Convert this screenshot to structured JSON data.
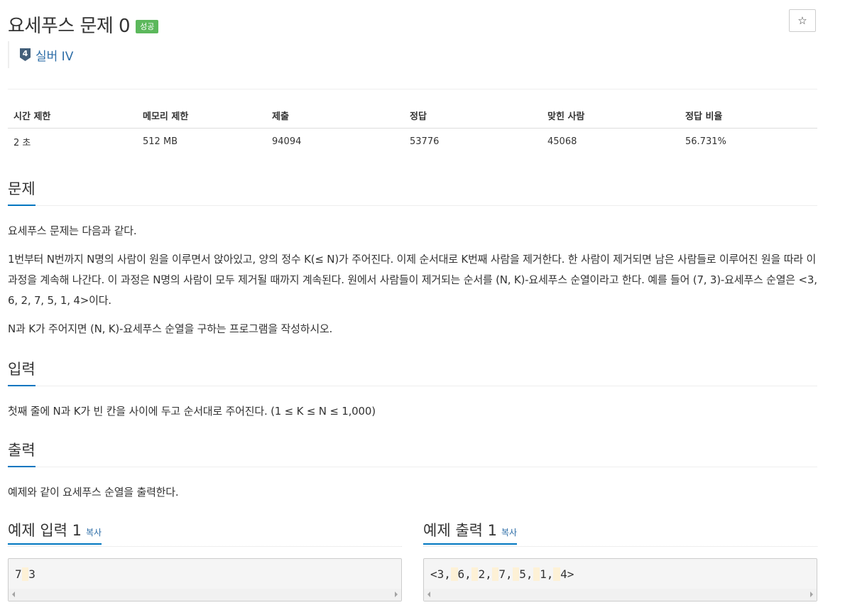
{
  "problem": {
    "title": "요세푸스 문제 0",
    "status_badge": "성공",
    "tier": "실버 IV",
    "tier_level": "4",
    "star_label": "☆"
  },
  "info_table": {
    "headers": [
      "시간 제한",
      "메모리 제한",
      "제출",
      "정답",
      "맞힌 사람",
      "정답 비율"
    ],
    "values": [
      "2 초",
      "512 MB",
      "94094",
      "53776",
      "45068",
      "56.731%"
    ]
  },
  "sections": {
    "description": {
      "title": "문제",
      "paragraphs": [
        "요세푸스 문제는 다음과 같다.",
        "1번부터 N번까지 N명의 사람이 원을 이루면서 앉아있고, 양의 정수 K(≤ N)가 주어진다. 이제 순서대로 K번째 사람을 제거한다. 한 사람이 제거되면 남은 사람들로 이루어진 원을 따라 이 과정을 계속해 나간다. 이 과정은 N명의 사람이 모두 제거될 때까지 계속된다. 원에서 사람들이 제거되는 순서를 (N, K)-요세푸스 순열이라고 한다. 예를 들어 (7, 3)-요세푸스 순열은 <3, 6, 2, 7, 5, 1, 4>이다.",
        "N과 K가 주어지면 (N, K)-요세푸스 순열을 구하는 프로그램을 작성하시오."
      ]
    },
    "input": {
      "title": "입력",
      "text": "첫째 줄에 N과 K가 빈 칸을 사이에 두고 순서대로 주어진다. (1 ≤ K ≤ N ≤ 1,000)"
    },
    "output": {
      "title": "출력",
      "text": "예제와 같이 요세푸스 순열을 출력한다."
    }
  },
  "samples": {
    "input": {
      "title": "예제 입력 1",
      "copy_label": "복사",
      "tokens": [
        "7",
        "3"
      ]
    },
    "output": {
      "title": "예제 출력 1",
      "copy_label": "복사",
      "tokens": [
        "<3,",
        "6,",
        "2,",
        "7,",
        "5,",
        "1,",
        "4>"
      ]
    }
  },
  "colors": {
    "accent": "#0076c0",
    "link": "#2d6da7",
    "badge_success": "#5cb85c",
    "tier_silver": "#435f7a",
    "whitespace_highlight": "#fdf1d6"
  }
}
